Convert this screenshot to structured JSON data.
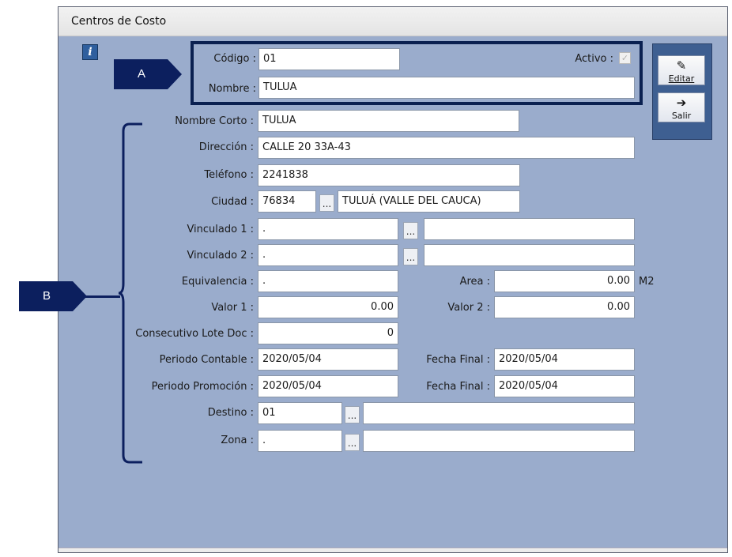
{
  "window": {
    "title": "Centros de Costo"
  },
  "callouts": {
    "a": "A",
    "b": "B"
  },
  "header_box": {
    "codigo": {
      "label": "Código :",
      "value": "01"
    },
    "nombre": {
      "label": "Nombre :",
      "value": "TULUA"
    },
    "activo": {
      "label": "Activo :",
      "checked": true,
      "check_glyph": "✓"
    }
  },
  "toolbar": {
    "editar": {
      "label": "Editar",
      "icon": "edit-icon",
      "glyph": "✎"
    },
    "salir": {
      "label": "Salir",
      "icon": "exit-icon",
      "glyph": "➔"
    }
  },
  "form": {
    "nombre_corto": {
      "label": "Nombre Corto :",
      "value": "TULUA"
    },
    "direccion": {
      "label": "Dirección :",
      "value": "CALLE 20 33A-43"
    },
    "telefono": {
      "label": "Teléfono :",
      "value": "2241838"
    },
    "ciudad": {
      "label": "Ciudad :",
      "code": "76834",
      "lookup": "...",
      "name": "TULUÁ (VALLE DEL CAUCA)"
    },
    "vinculado1": {
      "label": "Vinculado 1 :",
      "value": ".",
      "lookup": "...",
      "desc": ""
    },
    "vinculado2": {
      "label": "Vinculado 2 :",
      "value": ".",
      "lookup": "...",
      "desc": ""
    },
    "equivalencia": {
      "label": "Equivalencia :",
      "value": "."
    },
    "area": {
      "label": "Area :",
      "value": "0.00",
      "unit": "M2"
    },
    "valor1": {
      "label": "Valor 1 :",
      "value": "0.00"
    },
    "valor2": {
      "label": "Valor 2 :",
      "value": "0.00"
    },
    "consecutivo": {
      "label": "Consecutivo Lote  Doc :",
      "value": "0"
    },
    "periodo_contable": {
      "label": "Periodo Contable :",
      "value": "2020/05/04"
    },
    "fecha_final_1": {
      "label": "Fecha Final :",
      "value": "2020/05/04"
    },
    "periodo_promocion": {
      "label": "Periodo Promoción :",
      "value": "2020/05/04"
    },
    "fecha_final_2": {
      "label": "Fecha Final :",
      "value": "2020/05/04"
    },
    "destino": {
      "label": "Destino :",
      "value": "01",
      "lookup": "...",
      "desc": ""
    },
    "zona": {
      "label": "Zona :",
      "value": ".",
      "lookup": "...",
      "desc": ""
    }
  },
  "colors": {
    "panel": "#9aaccc",
    "callout": "#0c1f5e",
    "toolbar": "#3e5f91"
  }
}
